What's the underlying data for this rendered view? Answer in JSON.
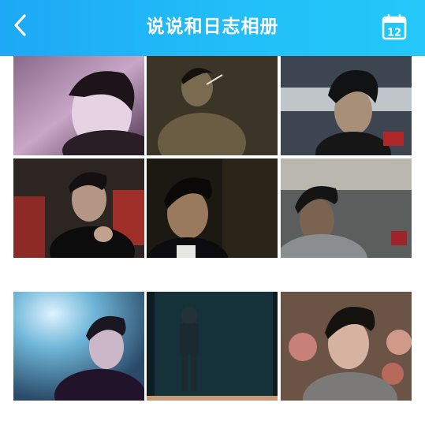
{
  "header": {
    "title": "说说和日志相册",
    "back_icon": "chevron-left-icon",
    "calendar_icon": "calendar-icon",
    "calendar_day": "12",
    "background": "#1ea8f5",
    "text_color": "#ffffff"
  },
  "photos": [
    {
      "name": "photo-1",
      "theme": "pink-lit portrait, dark hair"
    },
    {
      "name": "photo-2",
      "theme": "shirtless, smoking"
    },
    {
      "name": "photo-3",
      "theme": "internet cafe, spiky hair"
    },
    {
      "name": "photo-4",
      "theme": "hand to mouth, red chairs"
    },
    {
      "name": "photo-5",
      "theme": "dim room, dark jacket"
    },
    {
      "name": "photo-6",
      "theme": "gray hoodie, internet cafe"
    },
    {
      "name": "photo-7",
      "theme": "bright blue light, dark coat"
    },
    {
      "name": "photo-8",
      "theme": "dark blue full-body"
    },
    {
      "name": "photo-9",
      "theme": "floral sofa, gray tee"
    }
  ]
}
